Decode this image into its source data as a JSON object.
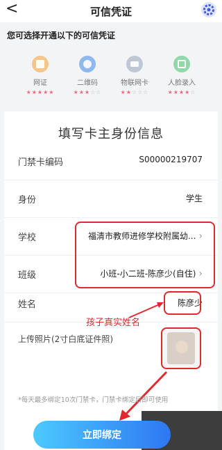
{
  "header": {
    "back_glyph": "<",
    "title": "可信凭证"
  },
  "section_title": "您可选择开通以下的可信凭证",
  "methods": [
    {
      "label": "网证",
      "stars_on": "★★★★★",
      "stars_off": "",
      "color": "#f4c68a",
      "icon": "id-card-icon"
    },
    {
      "label": "二维码",
      "stars_on": "★★★",
      "stars_off": "☆☆",
      "color": "#8fb7f0",
      "icon": "user-icon"
    },
    {
      "label": "物联网卡",
      "stars_on": "★★",
      "stars_off": "☆☆☆",
      "color": "#bfc7d6",
      "icon": "card-icon"
    },
    {
      "label": "人脸录入",
      "stars_on": "★★★★",
      "stars_off": "☆",
      "color": "#8fd8a8",
      "icon": "face-scan-icon"
    }
  ],
  "form": {
    "title": "填写卡主身份信息",
    "card_code_label": "门禁卡编码",
    "card_code_value": "S00000219707",
    "identity_label": "身份",
    "identity_value": "学生",
    "school_label": "学校",
    "school_value": "福清市教师进修学校附属幼...",
    "class_label": "班级",
    "class_value": "小班-小二班-陈彦少(自住)",
    "name_label": "姓名",
    "name_value": "陈彦少",
    "photo_label": "上传照片(2寸白底证件照)",
    "annotation": "孩子真实姓名",
    "note": "*每天最多绑定10次门禁卡，门禁卡绑定后即可使用",
    "submit_label": "立即绑定"
  },
  "colors": {
    "accent": "#2e78f2",
    "annotation_red": "#e0282e"
  }
}
